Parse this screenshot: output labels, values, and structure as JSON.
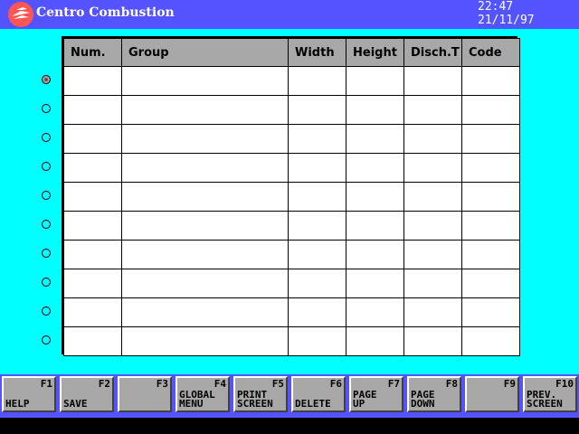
{
  "app": {
    "title": "Centro Combustion"
  },
  "clock": {
    "time": "22:47",
    "date": "21/11/97"
  },
  "table": {
    "columns": [
      "Num.",
      "Group",
      "Width",
      "Height",
      "Disch.T",
      "Code"
    ],
    "rows": [
      [
        "",
        "",
        "",
        "",
        "",
        ""
      ],
      [
        "",
        "",
        "",
        "",
        "",
        ""
      ],
      [
        "",
        "",
        "",
        "",
        "",
        ""
      ],
      [
        "",
        "",
        "",
        "",
        "",
        ""
      ],
      [
        "",
        "",
        "",
        "",
        "",
        ""
      ],
      [
        "",
        "",
        "",
        "",
        "",
        ""
      ],
      [
        "",
        "",
        "",
        "",
        "",
        ""
      ],
      [
        "",
        "",
        "",
        "",
        "",
        ""
      ],
      [
        "",
        "",
        "",
        "",
        "",
        ""
      ],
      [
        "",
        "",
        "",
        "",
        "",
        ""
      ]
    ],
    "selected_row": 0
  },
  "function_keys": [
    {
      "key": "F1",
      "label": "HELP"
    },
    {
      "key": "F2",
      "label": "SAVE"
    },
    {
      "key": "F3",
      "label": ""
    },
    {
      "key": "F4",
      "label": "GLOBAL\nMENU"
    },
    {
      "key": "F5",
      "label": "PRINT\nSCREEN"
    },
    {
      "key": "F6",
      "label": "DELETE"
    },
    {
      "key": "F7",
      "label": "PAGE\nUP"
    },
    {
      "key": "F8",
      "label": "PAGE\nDOWN"
    },
    {
      "key": "F9",
      "label": ""
    },
    {
      "key": "F10",
      "label": "PREV.\nSCREEN"
    }
  ],
  "colors": {
    "background": "#00ffff",
    "titlebar": "#5353ff",
    "header": "#a8a8a8",
    "logo": "#ff5555"
  },
  "icons": {
    "logo": "flame-logo-icon"
  }
}
